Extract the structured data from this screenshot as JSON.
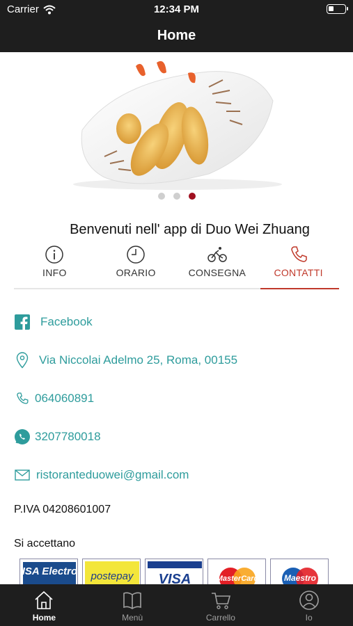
{
  "status": {
    "carrier": "Carrier",
    "time": "12:34 PM"
  },
  "nav": {
    "title": "Home"
  },
  "hero": {
    "active_slide": 3,
    "slide_count": 3
  },
  "welcome": "Benvenuti nell' app di Duo Wei Zhuang",
  "tabs": [
    {
      "label": "INFO",
      "icon": "info-icon"
    },
    {
      "label": "ORARIO",
      "icon": "clock-icon"
    },
    {
      "label": "CONSEGNA",
      "icon": "bicycle-icon"
    },
    {
      "label": "CONTATTI",
      "icon": "phone-icon",
      "active": true
    }
  ],
  "contacts": {
    "facebook": "Facebook",
    "address": "Via Niccolai Adelmo 25, Roma, 00155",
    "phone": "064060891",
    "whatsapp": "3207780018",
    "email": "ristoranteduowei@gmail.com"
  },
  "vat": "P.IVA 04208601007",
  "accepted_label": "Si accettano",
  "payment_cards": [
    "VISA Electron",
    "postepay",
    "VISA",
    "MasterCard",
    "Maestro"
  ],
  "tabbar": [
    {
      "label": "Home",
      "icon": "home-icon",
      "active": true
    },
    {
      "label": "Menù",
      "icon": "book-icon"
    },
    {
      "label": "Carrello",
      "icon": "cart-icon"
    },
    {
      "label": "Io",
      "icon": "user-icon"
    }
  ],
  "colors": {
    "accent": "#c0392b",
    "link": "#2e9c9c",
    "bar": "#1e1e1e",
    "dot_active": "#a01020"
  }
}
